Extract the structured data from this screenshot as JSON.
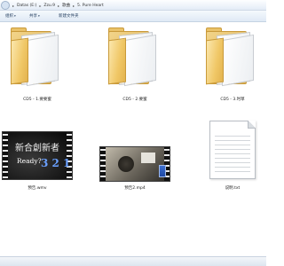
{
  "address_bar": {
    "crumbs": [
      "Datas (E:)",
      "Zzu.9",
      "歌曲",
      "5. Pure Heart"
    ]
  },
  "toolbar": {
    "organize_label": "组织",
    "share_label": "共享",
    "new_folder_label": "新建文件夹"
  },
  "items": [
    {
      "name": "CD5 - 1.要要蜜",
      "type": "folder"
    },
    {
      "name": "CD5 - 2.要蜜",
      "type": "folder"
    },
    {
      "name": "CD5 - 3.时草",
      "type": "folder"
    },
    {
      "name": "预告.wmv",
      "type": "video",
      "thumb_text": "新合創新者",
      "thumb_text2": "Ready?",
      "countdown": "3 2 1"
    },
    {
      "name": "预告2.mp4",
      "type": "video"
    },
    {
      "name": "说明.txt",
      "type": "text"
    }
  ],
  "colors": {
    "folder": "#f0c766",
    "toolbar_text": "#1e395b"
  }
}
